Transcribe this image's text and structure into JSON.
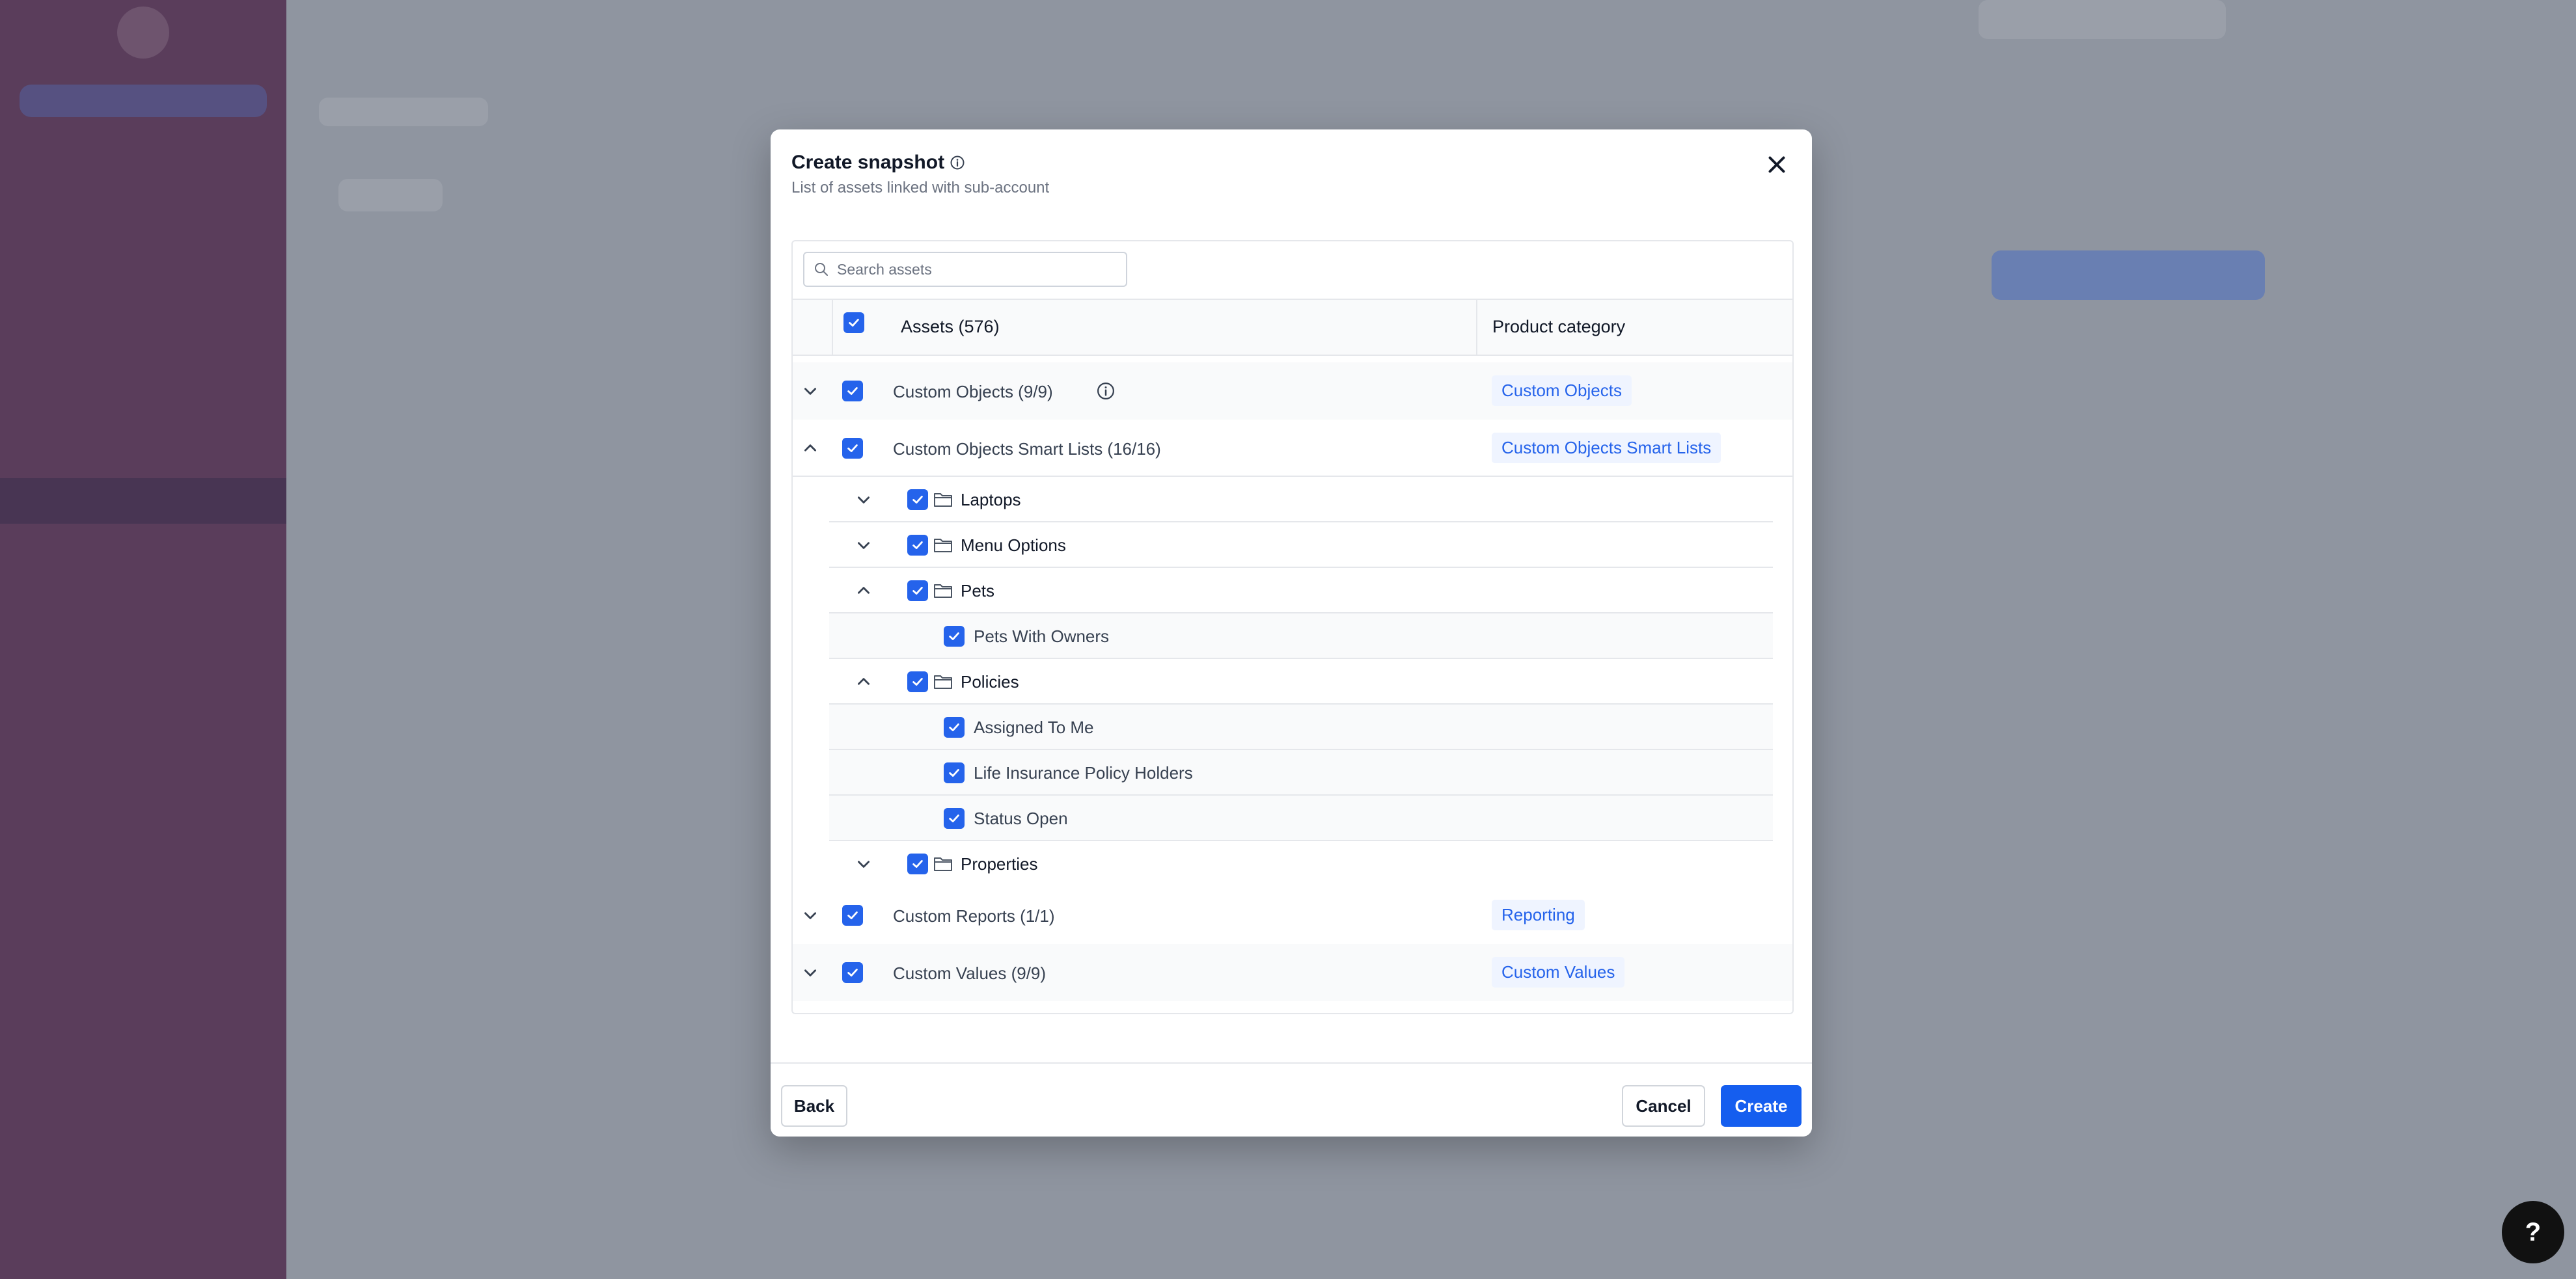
{
  "modal": {
    "title": "Create snapshot",
    "subtitle": "List of assets linked with sub-account",
    "search_placeholder": "Search assets",
    "header_assets": "Assets (576)",
    "header_category": "Product category",
    "rows": [
      {
        "label": "Custom Objects (9/9)",
        "category": "Custom Objects",
        "expanded": false,
        "checked": true
      },
      {
        "label": "Custom Objects Smart Lists (16/16)",
        "category": "Custom Objects Smart Lists",
        "expanded": true,
        "checked": true
      },
      {
        "label": "Custom Reports (1/1)",
        "category": "Reporting",
        "expanded": false,
        "checked": true
      },
      {
        "label": "Custom Values (9/9)",
        "category": "Custom Values",
        "expanded": false,
        "checked": true
      }
    ],
    "smart_lists": {
      "laptops": "Laptops",
      "menu_options": "Menu Options",
      "pets": "Pets",
      "pets_with_owners": "Pets With Owners",
      "policies": "Policies",
      "assigned_to_me": "Assigned To Me",
      "life_insurance": "Life Insurance Policy Holders",
      "status_open": "Status Open",
      "properties": "Properties"
    },
    "footer": {
      "back": "Back",
      "cancel": "Cancel",
      "create": "Create"
    }
  },
  "help_button": "?",
  "colors": {
    "accent": "#2563eb",
    "primary_button": "#155eef",
    "badge_bg": "#eff4ff"
  }
}
